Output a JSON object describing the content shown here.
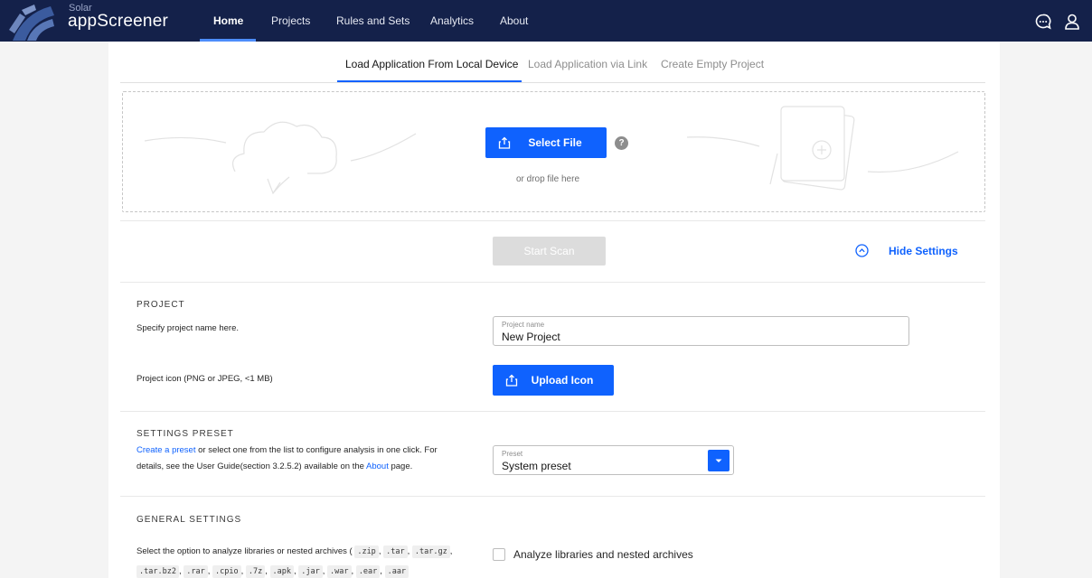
{
  "app": {
    "brand_small": "Solar",
    "brand_name": "appScreener"
  },
  "nav": {
    "items": [
      {
        "label": "Home",
        "active": true
      },
      {
        "label": "Projects"
      },
      {
        "label": "Rules and Sets"
      },
      {
        "label": "Analytics"
      },
      {
        "label": "About"
      }
    ],
    "icons": [
      "chat-icon",
      "user-icon"
    ]
  },
  "tabs": [
    {
      "label": "Load Application From Local Device",
      "active": true
    },
    {
      "label": "Load Application via Link"
    },
    {
      "label": "Create Empty Project"
    }
  ],
  "upload": {
    "select_file_label": "Select File",
    "drop_hint": "or drop file here",
    "help_glyph": "?"
  },
  "actions": {
    "start_scan_label": "Start Scan",
    "hide_settings_label": "Hide Settings"
  },
  "project": {
    "title": "PROJECT",
    "name_description": "Specify project name here.",
    "name_field_label": "Project name",
    "name_field_value": "New Project",
    "icon_description": "Project icon (PNG or JPEG, <1 MB)",
    "upload_icon_label": "Upload Icon"
  },
  "preset": {
    "title": "SETTINGS PRESET",
    "desc_link_create": "Create a preset",
    "desc_part1": " or select one from the list to configure analysis in one click. For details, see the User Guide(section 3.2.5.2) available on the ",
    "desc_link_about": "About",
    "desc_part2": " page.",
    "field_label": "Preset",
    "field_value": "System preset"
  },
  "general": {
    "title": "GENERAL SETTINGS",
    "desc_prefix": "Select the option to analyze libraries or nested archives (",
    "extensions": [
      ".zip",
      ".tar",
      ".tar.gz",
      ".tar.bz2",
      ".rar",
      ".cpio",
      ".7z",
      ".apk",
      ".jar",
      ".war",
      ".ear",
      ".aar"
    ],
    "checkbox_label": "Analyze libraries and nested archives",
    "checkbox_checked": false
  },
  "colors": {
    "topbar": "#14214a",
    "accent": "#0f62fe",
    "disabled": "#dcdcdc"
  }
}
